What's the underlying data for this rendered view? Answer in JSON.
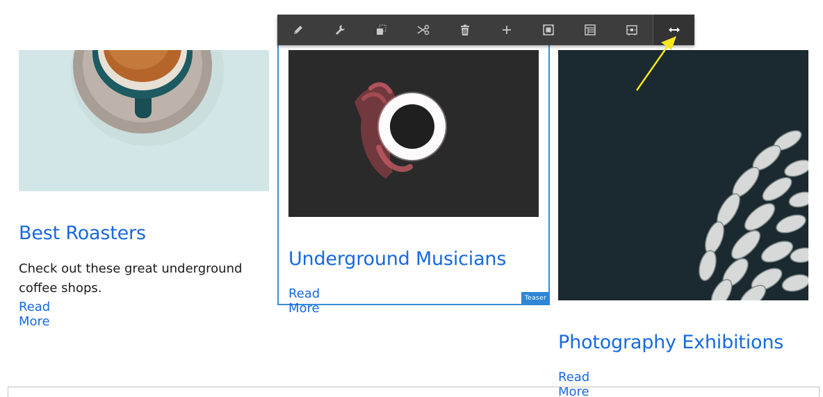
{
  "toolbar": {
    "buttons": [
      {
        "icon": "pencil-icon",
        "name": "edit-button"
      },
      {
        "icon": "wrench-icon",
        "name": "configure-button"
      },
      {
        "icon": "copy-icon",
        "name": "copy-button"
      },
      {
        "icon": "scissors-icon",
        "name": "cut-button"
      },
      {
        "icon": "trash-icon",
        "name": "delete-button"
      },
      {
        "icon": "plus-icon",
        "name": "insert-button"
      },
      {
        "icon": "group-icon",
        "name": "group-button"
      },
      {
        "icon": "layout-icon",
        "name": "layout-button"
      },
      {
        "icon": "styles-icon",
        "name": "styles-button"
      },
      {
        "icon": "resize-horizontal-icon",
        "name": "resize-button"
      }
    ]
  },
  "cards": [
    {
      "title": "Best Roasters",
      "description": "Check out these great underground coffee shops.",
      "read_more": "Read More"
    },
    {
      "title": "Underground Musicians",
      "read_more": "Read More",
      "badge": "Teaser"
    },
    {
      "title": "Photography Exhibitions",
      "read_more": "Read More"
    }
  ],
  "colors": {
    "link": "#1769e0",
    "selection": "#3b8bd8",
    "toolbar_bg": "#3d3d3d",
    "annotation": "#f7e61b"
  }
}
